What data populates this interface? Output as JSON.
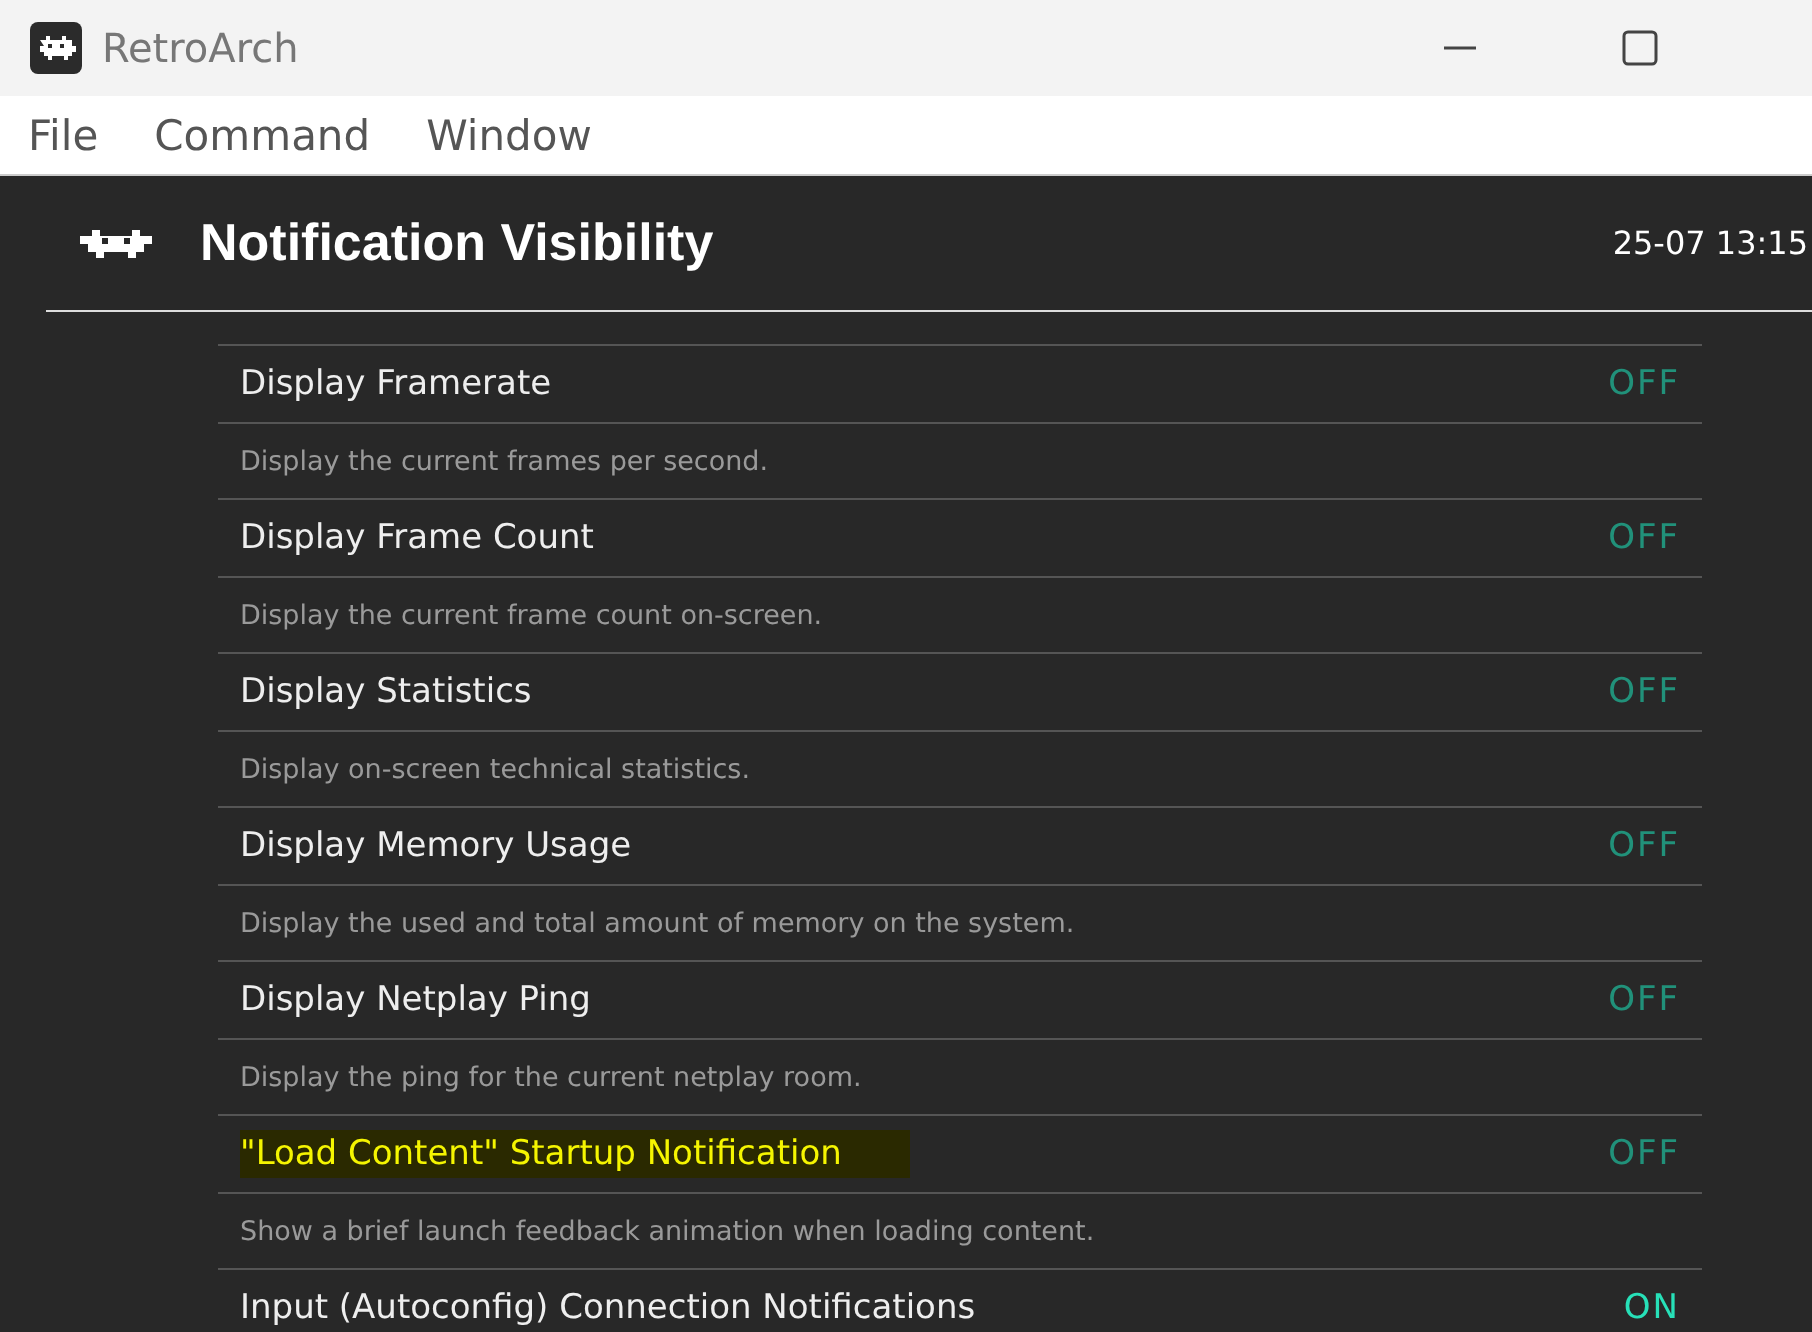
{
  "window": {
    "title": "RetroArch"
  },
  "menu": [
    "File",
    "Command",
    "Window"
  ],
  "header": {
    "title": "Notification Visibility",
    "clock": "25-07 13:15"
  },
  "settings": [
    {
      "label": "Display Framerate",
      "value": "OFF",
      "on": false,
      "selected": false,
      "description": "Display the current frames per second."
    },
    {
      "label": "Display Frame Count",
      "value": "OFF",
      "on": false,
      "selected": false,
      "description": "Display the current frame count on-screen."
    },
    {
      "label": "Display Statistics",
      "value": "OFF",
      "on": false,
      "selected": false,
      "description": "Display on-screen technical statistics."
    },
    {
      "label": "Display Memory Usage",
      "value": "OFF",
      "on": false,
      "selected": false,
      "description": "Display the used and total amount of memory on the system."
    },
    {
      "label": "Display Netplay Ping",
      "value": "OFF",
      "on": false,
      "selected": false,
      "description": "Display the ping for the current netplay room."
    },
    {
      "label": "\"Load Content\" Startup Notification",
      "value": "OFF",
      "on": false,
      "selected": true,
      "description": "Show a brief launch feedback animation when loading content."
    },
    {
      "label": "Input (Autoconfig) Connection Notifications",
      "value": "ON",
      "on": true,
      "selected": false
    }
  ]
}
